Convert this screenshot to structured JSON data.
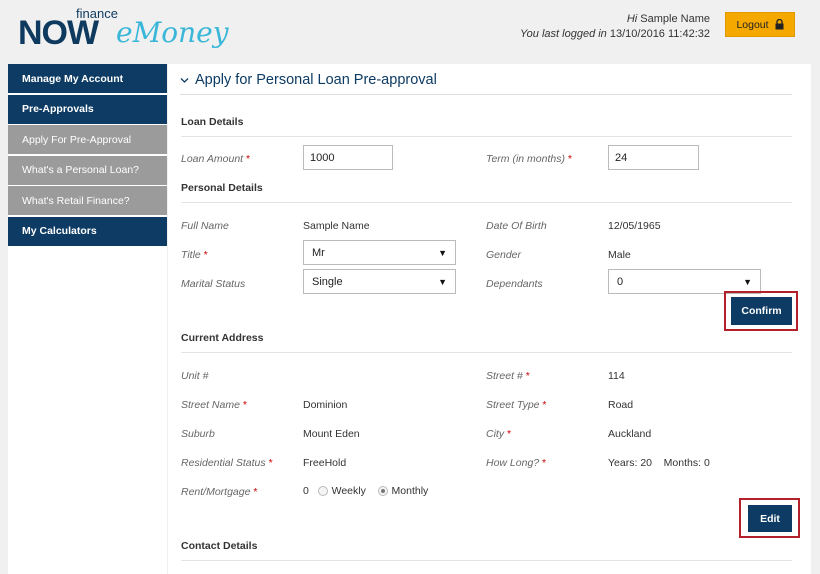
{
  "brand": {
    "finance": "finance",
    "now": "NOW",
    "emoney": "eMoney"
  },
  "header": {
    "greeting": "Hi",
    "user_name": "Sample Name",
    "last_login_prefix": "You last logged in",
    "last_login_time": "13/10/2016 11:42:32",
    "logout_label": "Logout"
  },
  "sidebar": {
    "items": [
      {
        "label": "Manage My Account"
      },
      {
        "label": "Pre-Approvals"
      },
      {
        "label": "Apply For Pre-Approval"
      },
      {
        "label": "What's a Personal Loan?"
      },
      {
        "label": "What's Retail Finance?"
      },
      {
        "label": "My Calculators"
      }
    ]
  },
  "page": {
    "title": "Apply for Personal Loan Pre-approval"
  },
  "loan": {
    "heading": "Loan Details",
    "amount_label": "Loan Amount",
    "amount_value": "1000",
    "term_label": "Term (in months)",
    "term_value": "24"
  },
  "personal": {
    "heading": "Personal Details",
    "full_name_label": "Full Name",
    "full_name_value": "Sample Name",
    "dob_label": "Date Of Birth",
    "dob_value": "12/05/1965",
    "title_label": "Title",
    "title_value": "Mr",
    "gender_label": "Gender",
    "gender_value": "Male",
    "marital_label": "Marital Status",
    "marital_value": "Single",
    "dependants_label": "Dependants",
    "dependants_value": "0",
    "confirm_label": "Confirm"
  },
  "address": {
    "heading": "Current Address",
    "unit_label": "Unit #",
    "street_no_label": "Street #",
    "street_no_value": "114",
    "street_name_label": "Street Name",
    "street_name_value": "Dominion",
    "street_type_label": "Street Type",
    "street_type_value": "Road",
    "suburb_label": "Suburb",
    "suburb_value": "Mount Eden",
    "city_label": "City",
    "city_value": "Auckland",
    "residential_label": "Residential Status",
    "residential_value": "FreeHold",
    "how_long_label": "How Long?",
    "years_label": "Years:",
    "years_value": "20",
    "months_label": "Months:",
    "months_value": "0",
    "rent_label": "Rent/Mortgage",
    "rent_value": "0",
    "weekly_label": "Weekly",
    "monthly_label": "Monthly",
    "edit_label": "Edit"
  },
  "contact": {
    "heading": "Contact Details"
  },
  "required_mark": "*"
}
